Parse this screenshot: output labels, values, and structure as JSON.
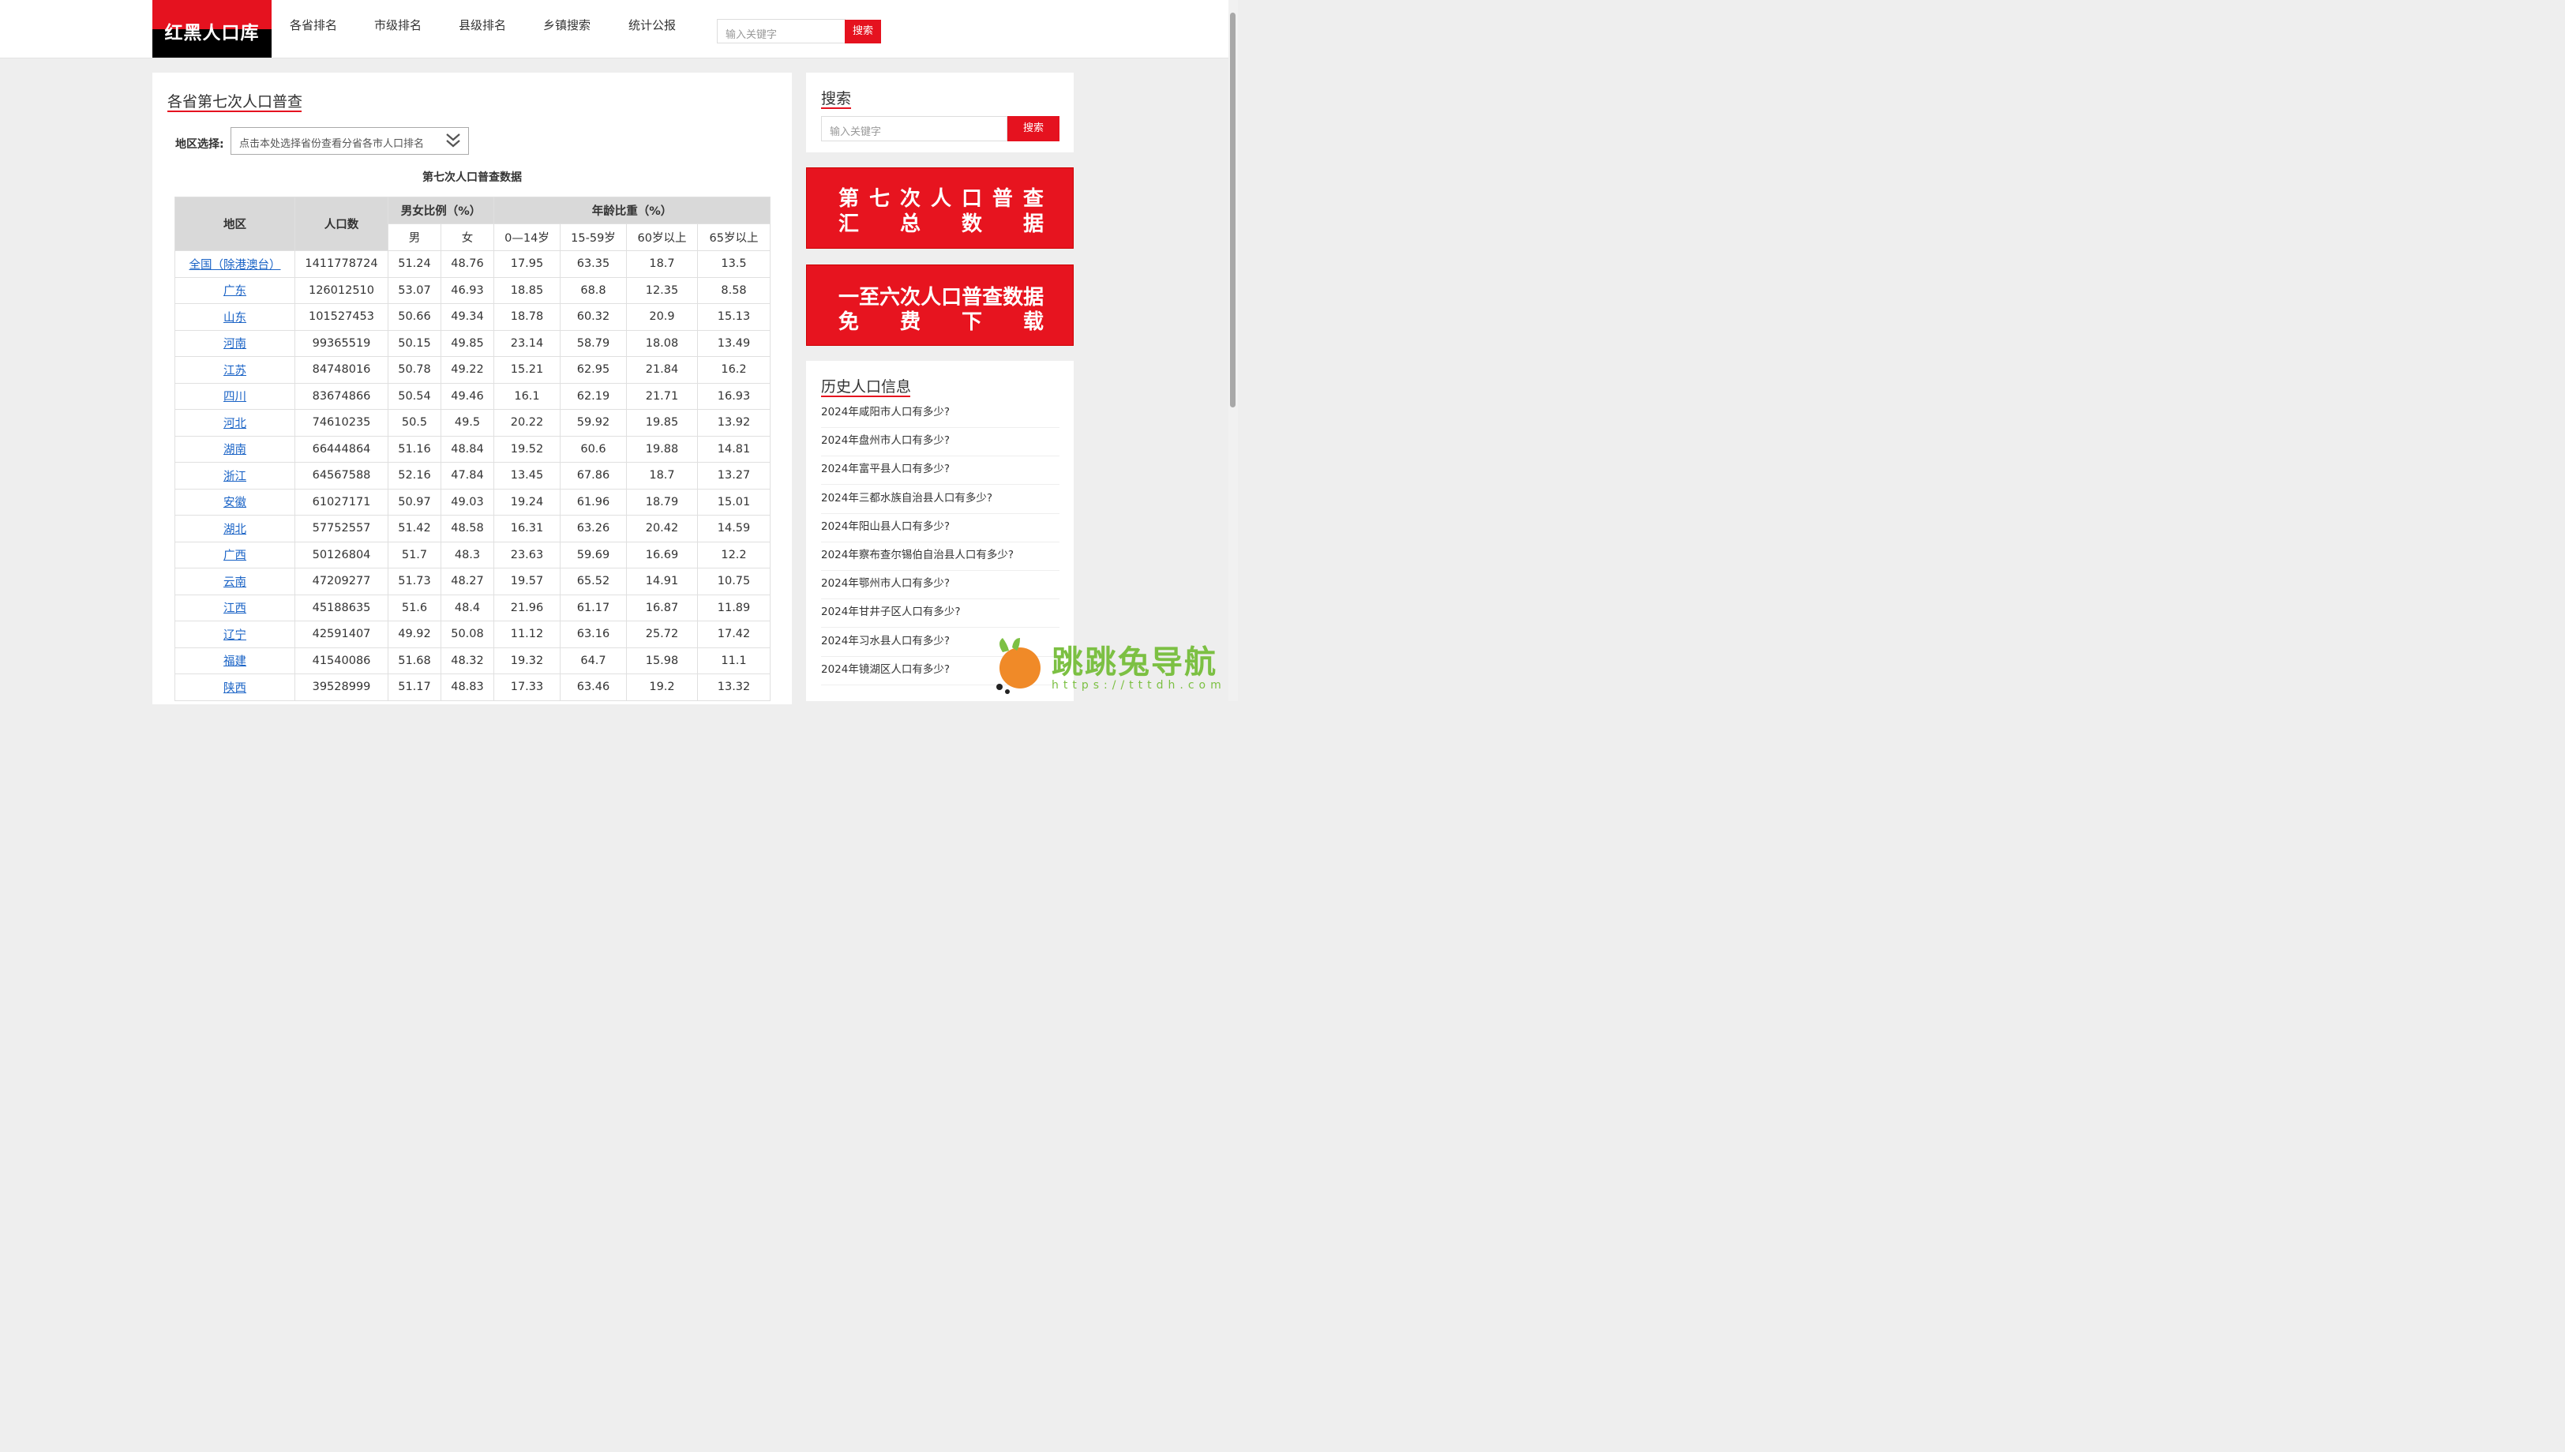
{
  "header": {
    "logo_text": "红黑人口库",
    "nav": [
      "各省排名",
      "市级排名",
      "县级排名",
      "乡镇搜索",
      "统计公报"
    ],
    "search_placeholder": "输入关键字",
    "search_button": "搜索"
  },
  "main": {
    "title": "各省第七次人口普查",
    "region_label": "地区选择:",
    "region_select": "点击本处选择省份查看分省各市人口排名",
    "table_title": "第七次人口普查数据",
    "table": {
      "headers": {
        "region": "地区",
        "population": "人口数",
        "sex_ratio": "男女比例（%）",
        "age_ratio": "年龄比重（%）",
        "male": "男",
        "female": "女",
        "age_0_14": "0—14岁",
        "age_15_59": "15-59岁",
        "age_60": "60岁以上",
        "age_65": "65岁以上"
      },
      "rows": [
        [
          "全国（除港澳台）",
          "1411778724",
          "51.24",
          "48.76",
          "17.95",
          "63.35",
          "18.7",
          "13.5"
        ],
        [
          "广东",
          "126012510",
          "53.07",
          "46.93",
          "18.85",
          "68.8",
          "12.35",
          "8.58"
        ],
        [
          "山东",
          "101527453",
          "50.66",
          "49.34",
          "18.78",
          "60.32",
          "20.9",
          "15.13"
        ],
        [
          "河南",
          "99365519",
          "50.15",
          "49.85",
          "23.14",
          "58.79",
          "18.08",
          "13.49"
        ],
        [
          "江苏",
          "84748016",
          "50.78",
          "49.22",
          "15.21",
          "62.95",
          "21.84",
          "16.2"
        ],
        [
          "四川",
          "83674866",
          "50.54",
          "49.46",
          "16.1",
          "62.19",
          "21.71",
          "16.93"
        ],
        [
          "河北",
          "74610235",
          "50.5",
          "49.5",
          "20.22",
          "59.92",
          "19.85",
          "13.92"
        ],
        [
          "湖南",
          "66444864",
          "51.16",
          "48.84",
          "19.52",
          "60.6",
          "19.88",
          "14.81"
        ],
        [
          "浙江",
          "64567588",
          "52.16",
          "47.84",
          "13.45",
          "67.86",
          "18.7",
          "13.27"
        ],
        [
          "安徽",
          "61027171",
          "50.97",
          "49.03",
          "19.24",
          "61.96",
          "18.79",
          "15.01"
        ],
        [
          "湖北",
          "57752557",
          "51.42",
          "48.58",
          "16.31",
          "63.26",
          "20.42",
          "14.59"
        ],
        [
          "广西",
          "50126804",
          "51.7",
          "48.3",
          "23.63",
          "59.69",
          "16.69",
          "12.2"
        ],
        [
          "云南",
          "47209277",
          "51.73",
          "48.27",
          "19.57",
          "65.52",
          "14.91",
          "10.75"
        ],
        [
          "江西",
          "45188635",
          "51.6",
          "48.4",
          "21.96",
          "61.17",
          "16.87",
          "11.89"
        ],
        [
          "辽宁",
          "42591407",
          "49.92",
          "50.08",
          "11.12",
          "63.16",
          "25.72",
          "17.42"
        ],
        [
          "福建",
          "41540086",
          "51.68",
          "48.32",
          "19.32",
          "64.7",
          "15.98",
          "11.1"
        ],
        [
          "陕西",
          "39528999",
          "51.17",
          "48.83",
          "17.33",
          "63.46",
          "19.2",
          "13.32"
        ]
      ]
    }
  },
  "sidebar": {
    "search_title": "搜索",
    "search_placeholder": "输入关键字",
    "search_button": "搜索",
    "banner1_line1": [
      "第",
      "七",
      "次",
      "人",
      "口",
      "普",
      "查"
    ],
    "banner1_line2": [
      "汇",
      "总",
      "数",
      "据"
    ],
    "banner2_line1": [
      "一",
      "至",
      "六",
      "次",
      "人",
      "口",
      "普",
      "查",
      "数",
      "据"
    ],
    "banner2_line2": [
      "免",
      "费",
      "下",
      "载"
    ],
    "history_title": "历史人口信息",
    "history": [
      "2024年咸阳市人口有多少?",
      "2024年盘州市人口有多少?",
      "2024年富平县人口有多少?",
      "2024年三都水族自治县人口有多少?",
      "2024年阳山县人口有多少?",
      "2024年察布查尔锡伯自治县人口有多少?",
      "2024年鄂州市人口有多少?",
      "2024年甘井子区人口有多少?",
      "2024年习水县人口有多少?",
      "2024年镜湖区人口有多少?"
    ]
  },
  "watermark": {
    "text": "跳跳兔导航",
    "url": "https://tttdh.com"
  },
  "colors": {
    "brand_red": "#e5121f",
    "link_blue": "#1a63c6",
    "watermark_green": "#7cc043"
  }
}
